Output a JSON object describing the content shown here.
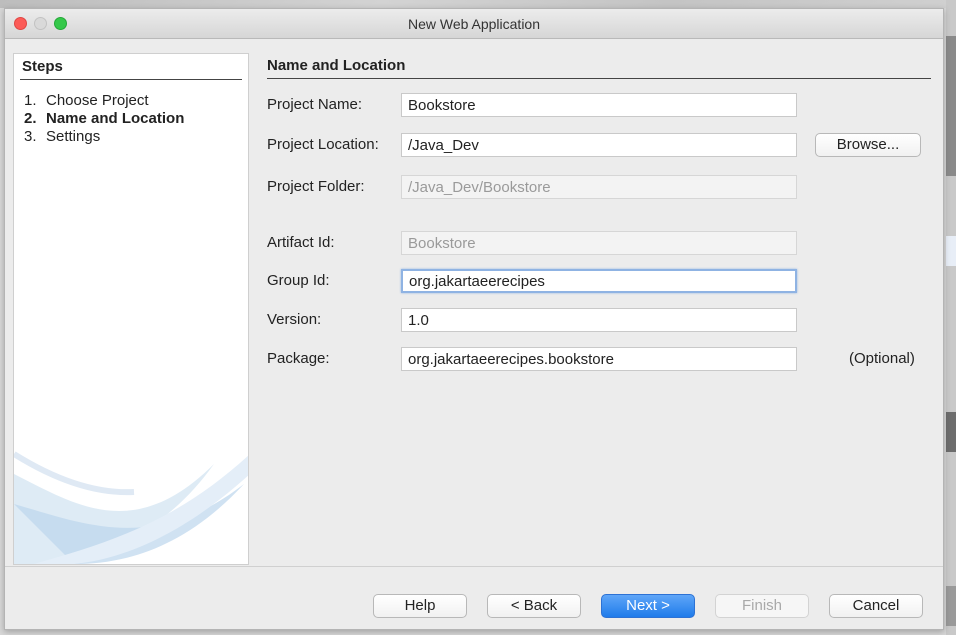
{
  "window": {
    "title": "New Web Application"
  },
  "steps_panel": {
    "heading": "Steps",
    "items": [
      {
        "num": "1.",
        "label": "Choose Project"
      },
      {
        "num": "2.",
        "label": "Name and Location"
      },
      {
        "num": "3.",
        "label": "Settings"
      }
    ]
  },
  "form": {
    "heading": "Name and Location",
    "project_name": {
      "label": "Project Name:",
      "value": "Bookstore"
    },
    "project_location": {
      "label": "Project Location:",
      "value": "/Java_Dev"
    },
    "project_folder": {
      "label": "Project Folder:",
      "value": "/Java_Dev/Bookstore"
    },
    "artifact_id": {
      "label": "Artifact Id:",
      "value": "Bookstore"
    },
    "group_id": {
      "label": "Group Id:",
      "value": "org.jakartaeerecipes"
    },
    "version": {
      "label": "Version:",
      "value": "1.0"
    },
    "package": {
      "label": "Package:",
      "value": "org.jakartaeerecipes.bookstore",
      "hint": "(Optional)"
    },
    "browse_label": "Browse..."
  },
  "buttons": {
    "help": "Help",
    "back": "< Back",
    "next": "Next >",
    "finish": "Finish",
    "cancel": "Cancel"
  },
  "colors": {
    "primary_button": "#1f7bea",
    "close": "#fc5b57",
    "maximize": "#35c84a"
  }
}
